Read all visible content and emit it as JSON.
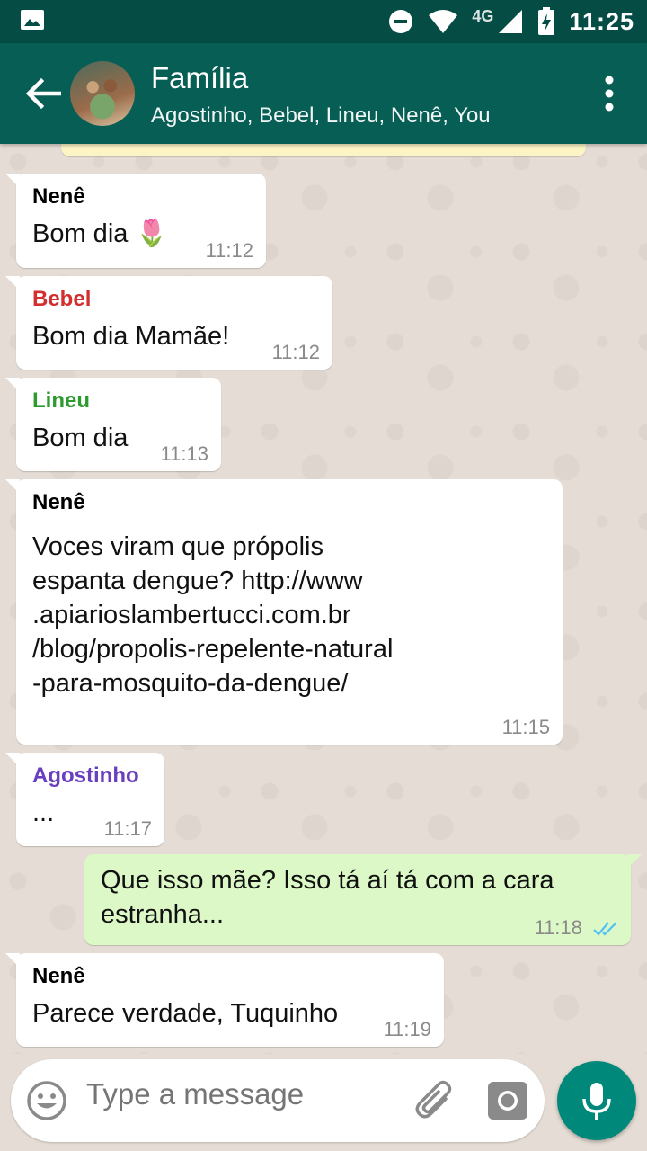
{
  "status_bar": {
    "network_label": "4G",
    "time": "11:25"
  },
  "header": {
    "title": "Família",
    "subtitle": "Agostinho, Bebel, Lineu, Nenê, You",
    "avatar_icon": "group-photo",
    "back_icon": "arrow-back-icon",
    "menu_icon": "more-vert-icon"
  },
  "messages": [
    {
      "direction": "in",
      "sender": "Nenê",
      "sender_color": "#000000",
      "text": "Bom dia 🌷",
      "time": "11:12"
    },
    {
      "direction": "in",
      "sender": "Bebel",
      "sender_color": "#d32f2f",
      "text": "Bom dia Mamãe!",
      "time": "11:12"
    },
    {
      "direction": "in",
      "sender": "Lineu",
      "sender_color": "#2e9b2e",
      "text": "Bom dia",
      "time": "11:13"
    },
    {
      "direction": "in",
      "sender": "Nenê",
      "sender_color": "#000000",
      "text_lines": [
        "Voces viram que própolis",
        "espanta dengue? http://www",
        ".apiarioslambertucci.com.br",
        "/blog/propolis-repelente-natural",
        "-para-mosquito-da-dengue/"
      ],
      "time": "11:15"
    },
    {
      "direction": "in",
      "sender": "Agostinho",
      "sender_color": "#6a3fbf",
      "text": "...",
      "time": "11:17"
    },
    {
      "direction": "out",
      "text_lines": [
        "Que isso mãe? Isso tá aí tá com a cara",
        "estranha..."
      ],
      "time": "11:18",
      "status": "read",
      "status_color": "#4fc3f7"
    },
    {
      "direction": "in",
      "sender": "Nenê",
      "sender_color": "#000000",
      "text": "Parece verdade, Tuquinho",
      "time": "11:19"
    }
  ],
  "input": {
    "placeholder": "Type a message",
    "emoji_icon": "emoji-icon",
    "attach_icon": "paperclip-icon",
    "camera_icon": "camera-icon",
    "mic_icon": "mic-icon"
  },
  "colors": {
    "header": "#075e54",
    "status_bar": "#054d44",
    "outgoing_bubble": "#dcf8c6",
    "incoming_bubble": "#ffffff",
    "fab": "#00897b"
  }
}
